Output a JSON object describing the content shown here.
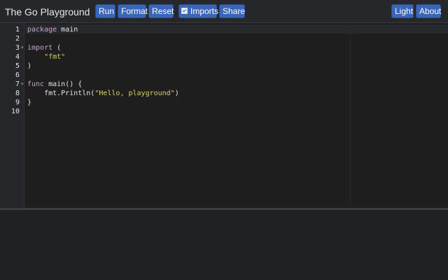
{
  "header": {
    "title": "The Go Playground",
    "buttons": {
      "run": "Run",
      "format": "Format",
      "reset": "Reset",
      "imports": "Imports",
      "share": "Share",
      "light": "Light",
      "about": "About"
    },
    "imports_checked": true
  },
  "editor": {
    "line_numbers": [
      "1",
      "2",
      "3",
      "4",
      "5",
      "6",
      "7",
      "8",
      "9",
      "10"
    ],
    "lines": [
      {
        "kw": "package",
        "rest": " main"
      },
      {
        "text": ""
      },
      {
        "kw": "import",
        "rest": " ("
      },
      {
        "indent": "    ",
        "str": "\"fmt\""
      },
      {
        "text": ")"
      },
      {
        "text": ""
      },
      {
        "kw": "func",
        "rest": " main() {"
      },
      {
        "pre": "    fmt.Println(",
        "str": "\"Hello, playground\"",
        "post": ")"
      },
      {
        "text": "}"
      },
      {
        "text": ""
      }
    ]
  },
  "colors": {
    "button": "#3a66b7",
    "keyword": "#c8a2c8",
    "string": "#d9d26a",
    "background": "#1e1e1e"
  }
}
